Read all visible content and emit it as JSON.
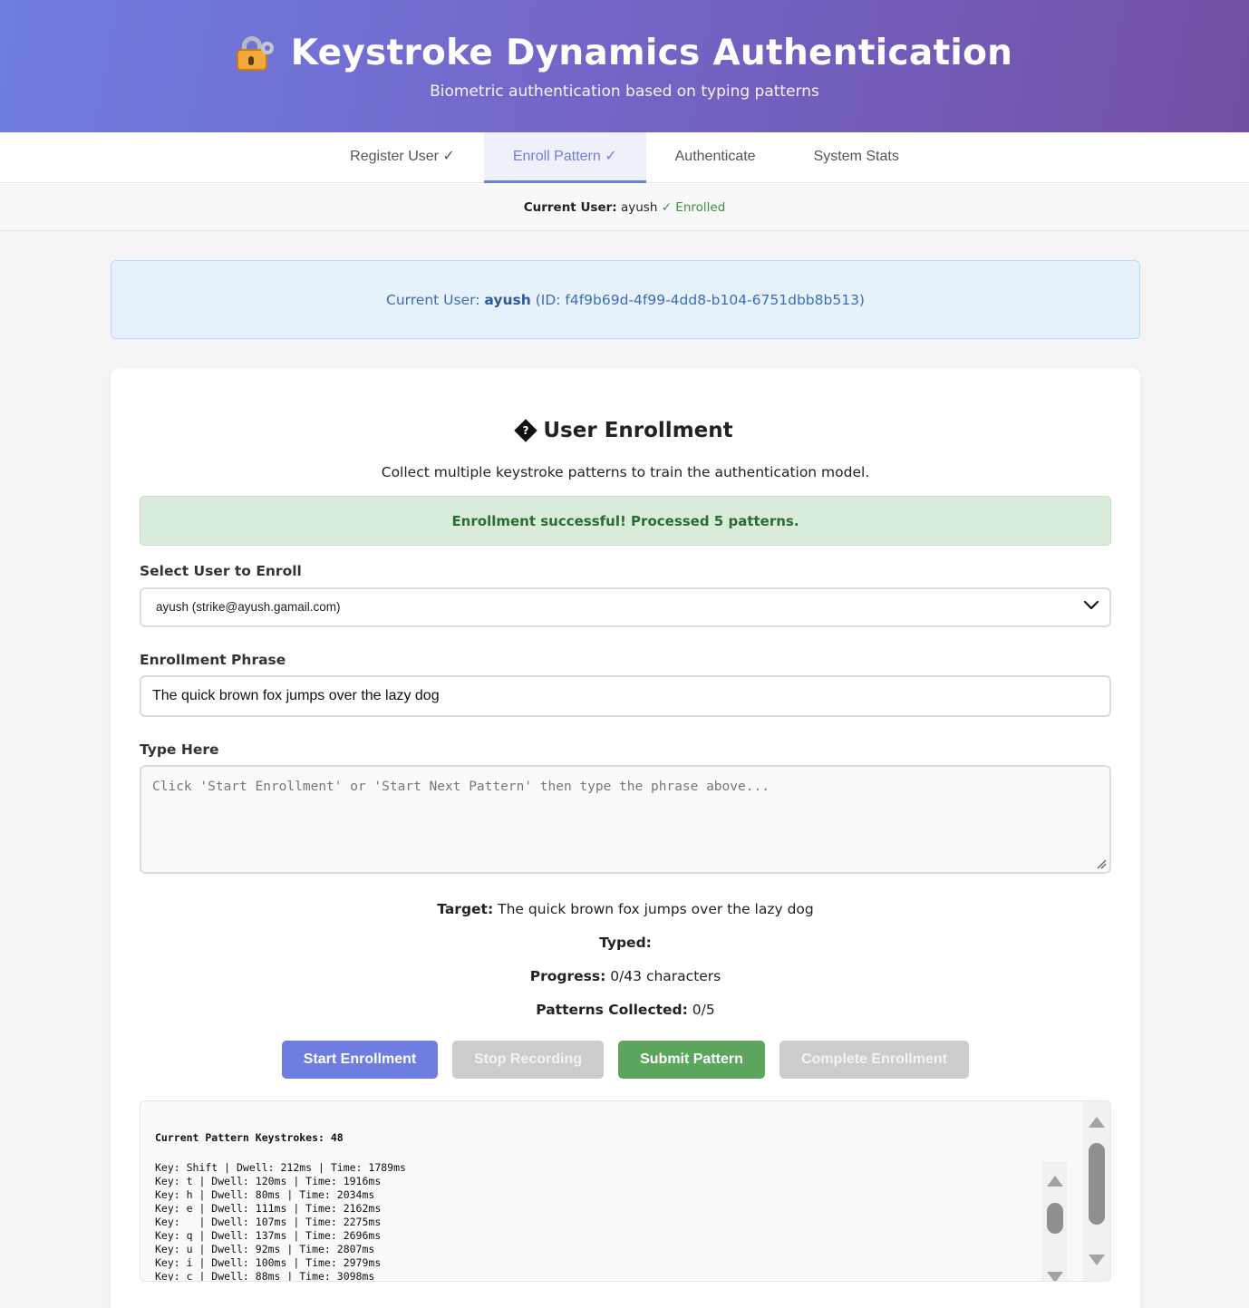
{
  "header": {
    "title": "Keystroke Dynamics Authentication",
    "subtitle": "Biometric authentication based on typing patterns"
  },
  "tabs": [
    {
      "label": "Register User ✓",
      "active": false
    },
    {
      "label": "Enroll Pattern ✓",
      "active": true
    },
    {
      "label": "Authenticate",
      "active": false
    },
    {
      "label": "System Stats",
      "active": false
    }
  ],
  "userbar": {
    "label": "Current User:",
    "name": "ayush",
    "status": "✓ Enrolled"
  },
  "info": {
    "prefix": "Current User:",
    "name": "ayush",
    "id_text": "(ID: f4f9b69d-4f99-4dd8-b104-6751dbb8b513)"
  },
  "enrollment": {
    "title": "User Enrollment",
    "description": "Collect multiple keystroke patterns to train the authentication model.",
    "success_message": "Enrollment successful! Processed 5 patterns.",
    "select_label": "Select User to Enroll",
    "selected_user": "ayush (strike@ayush.gamail.com)",
    "phrase_label": "Enrollment Phrase",
    "phrase_value": "The quick brown fox jumps over the lazy dog",
    "type_label": "Type Here",
    "type_placeholder": "Click 'Start Enrollment' or 'Start Next Pattern' then type the phrase above...",
    "target_label": "Target:",
    "target_value": "The quick brown fox jumps over the lazy dog",
    "typed_label": "Typed:",
    "typed_value": "",
    "progress_label": "Progress:",
    "progress_value": "0/43 characters",
    "patterns_label": "Patterns Collected:",
    "patterns_value": "0/5"
  },
  "buttons": {
    "start": "Start Enrollment",
    "stop": "Stop Recording",
    "submit": "Submit Pattern",
    "complete": "Complete Enrollment"
  },
  "log": {
    "heading": "Current Pattern Keystrokes: 48",
    "lines": [
      "Key: Shift | Dwell: 212ms | Time: 1789ms",
      "Key: t | Dwell: 120ms | Time: 1916ms",
      "Key: h | Dwell: 80ms | Time: 2034ms",
      "Key: e | Dwell: 111ms | Time: 2162ms",
      "Key:   | Dwell: 107ms | Time: 2275ms",
      "Key: q | Dwell: 137ms | Time: 2696ms",
      "Key: u | Dwell: 92ms | Time: 2807ms",
      "Key: i | Dwell: 100ms | Time: 2979ms",
      "Key: c | Dwell: 88ms | Time: 3098ms"
    ]
  },
  "icons": {
    "title_icon": "lock-with-key-icon",
    "enrollment_icon": "unknown-glyph-icon"
  },
  "colors": {
    "accent": "#6f7de0",
    "success": "#5ca55e",
    "disabled": "#cccccc"
  }
}
